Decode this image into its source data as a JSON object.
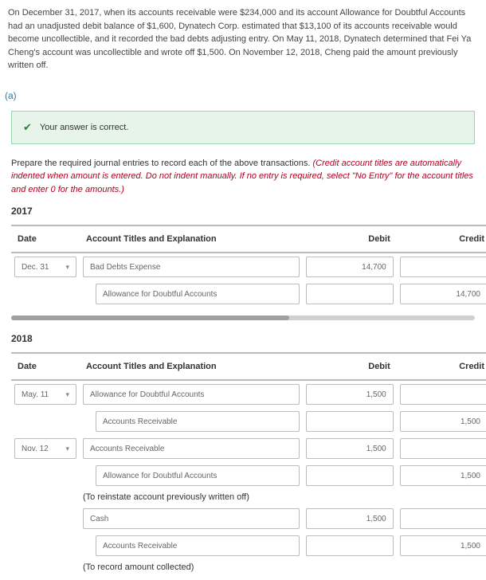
{
  "problem_text": "On December 31, 2017, when its accounts receivable were $234,000 and its account Allowance for Doubtful Accounts had an unadjusted debit balance of $1,600, Dynatech Corp. estimated that $13,100 of its accounts receivable would become uncollectible, and it recorded the bad debts adjusting entry. On May 11, 2018, Dynatech determined that Fei Ya Cheng's account was uncollectible and wrote off $1,500. On November 12, 2018, Cheng paid the amount previously written off.",
  "part_label": "(a)",
  "success_msg": "Your answer is correct.",
  "instructions_main": "Prepare the required journal entries to record each of the above transactions. ",
  "instructions_italic": "(Credit account titles are automatically indented when amount is entered. Do not indent manually. If no entry is required, select \"No Entry\" for the account titles and enter 0 for the amounts.)",
  "years": {
    "y2017": "2017",
    "y2018": "2018"
  },
  "headers": {
    "date": "Date",
    "acct": "Account Titles and Explanation",
    "debit": "Debit",
    "credit": "Credit"
  },
  "j2017": {
    "r1": {
      "date": "Dec. 31",
      "acct": "Bad Debts Expense",
      "debit": "14,700",
      "credit": ""
    },
    "r2": {
      "acct": "Allowance for Doubtful Accounts",
      "debit": "",
      "credit": "14,700"
    }
  },
  "j2018": {
    "r1": {
      "date": "May. 11",
      "acct": "Allowance for Doubtful Accounts",
      "debit": "1,500",
      "credit": ""
    },
    "r2": {
      "acct": "Accounts Receivable",
      "debit": "",
      "credit": "1,500"
    },
    "r3": {
      "date": "Nov. 12",
      "acct": "Accounts Receivable",
      "debit": "1,500",
      "credit": ""
    },
    "r4": {
      "acct": "Allowance for Doubtful Accounts",
      "debit": "",
      "credit": "1,500"
    },
    "note1": "(To reinstate account previously written off)",
    "r5": {
      "acct": "Cash",
      "debit": "1,500",
      "credit": ""
    },
    "r6": {
      "acct": "Accounts Receivable",
      "debit": "",
      "credit": "1,500"
    },
    "note2": "(To record amount collected)"
  }
}
